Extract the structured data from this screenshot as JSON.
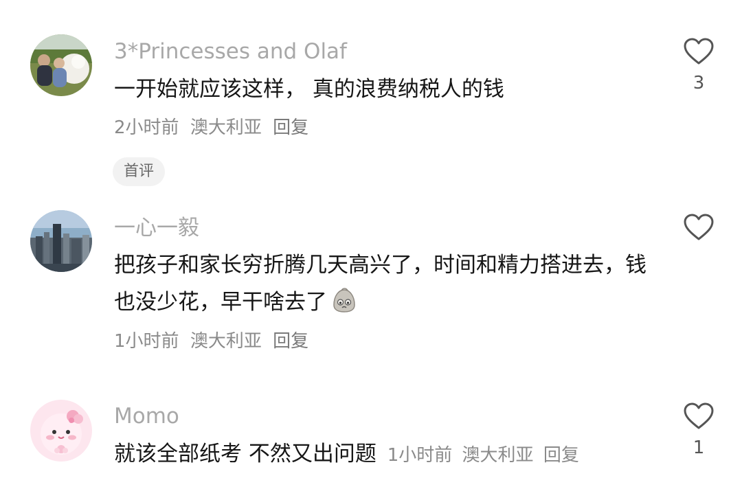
{
  "comments": [
    {
      "username": "3*Princesses and Olaf",
      "text": "一开始就应该这样， 真的浪费纳税人的钱",
      "time": "2小时前",
      "location": "澳大利亚",
      "reply_label": "回复",
      "tag": "首评",
      "like_count": "3"
    },
    {
      "username": "一心一毅",
      "text": "把孩子和家长穷折腾几天高兴了，时间和精力搭进去，钱也没少花，早干啥去了",
      "time": "1小时前",
      "location": "澳大利亚",
      "reply_label": "回复",
      "like_count": ""
    },
    {
      "username": "Momo",
      "text": "就该全部纸考 不然又出问题",
      "time": "1小时前",
      "location": "澳大利亚",
      "reply_label": "回复",
      "like_count": "1"
    }
  ],
  "icons": {
    "like": "heart-outline-icon",
    "emoji": "sad-face-emoji-icon"
  },
  "colors": {
    "username": "#a8a8a8",
    "meta": "#8a8a8a",
    "tag_bg": "#f2f2f2"
  }
}
